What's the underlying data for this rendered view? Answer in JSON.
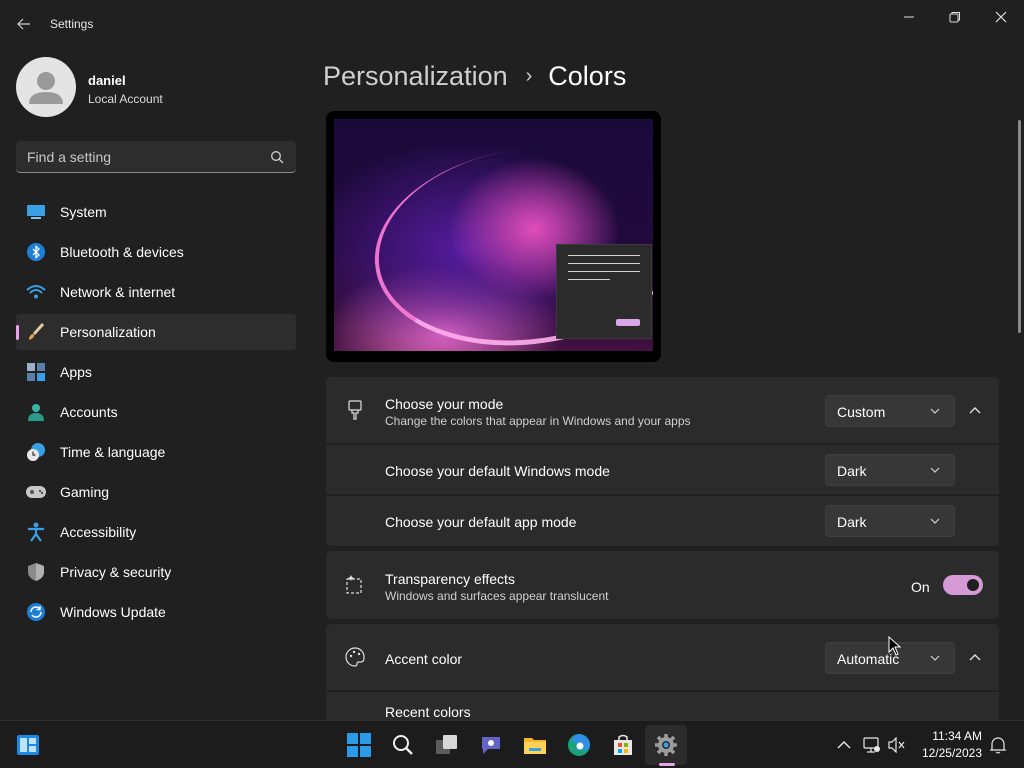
{
  "window": {
    "title": "Settings",
    "controls": [
      "minimize",
      "maximize",
      "close"
    ]
  },
  "profile": {
    "name": "daniel",
    "account_type": "Local Account"
  },
  "search": {
    "placeholder": "Find a setting"
  },
  "sidebar": {
    "items": [
      {
        "label": "System",
        "icon": "system-icon"
      },
      {
        "label": "Bluetooth & devices",
        "icon": "bluetooth-icon"
      },
      {
        "label": "Network & internet",
        "icon": "wifi-icon"
      },
      {
        "label": "Personalization",
        "icon": "brush-icon",
        "active": true
      },
      {
        "label": "Apps",
        "icon": "apps-icon"
      },
      {
        "label": "Accounts",
        "icon": "accounts-icon"
      },
      {
        "label": "Time & language",
        "icon": "time-language-icon"
      },
      {
        "label": "Gaming",
        "icon": "gamepad-icon"
      },
      {
        "label": "Accessibility",
        "icon": "accessibility-icon"
      },
      {
        "label": "Privacy & security",
        "icon": "shield-icon"
      },
      {
        "label": "Windows Update",
        "icon": "update-icon"
      }
    ]
  },
  "breadcrumb": {
    "parent": "Personalization",
    "separator": "›",
    "current": "Colors"
  },
  "mode_card": {
    "title": "Choose your mode",
    "subtitle": "Change the colors that appear in Windows and your apps",
    "value": "Custom",
    "windows_mode_label": "Choose your default Windows mode",
    "windows_mode_value": "Dark",
    "app_mode_label": "Choose your default app mode",
    "app_mode_value": "Dark"
  },
  "transparency_card": {
    "title": "Transparency effects",
    "subtitle": "Windows and surfaces appear translucent",
    "state_label": "On",
    "enabled": true
  },
  "accent_card": {
    "title": "Accent color",
    "value": "Automatic",
    "recent_colors_label": "Recent colors"
  },
  "taskbar": {
    "apps": [
      "widgets-icon",
      "start-icon",
      "search-icon",
      "task-view-icon",
      "teams-chat-icon",
      "file-explorer-icon",
      "edge-icon",
      "store-icon",
      "settings-icon"
    ],
    "time": "11:34 AM",
    "date": "12/25/2023"
  },
  "colors": {
    "accent": "#e7a5e6",
    "background": "#202020",
    "card": "#2b2b2b"
  }
}
